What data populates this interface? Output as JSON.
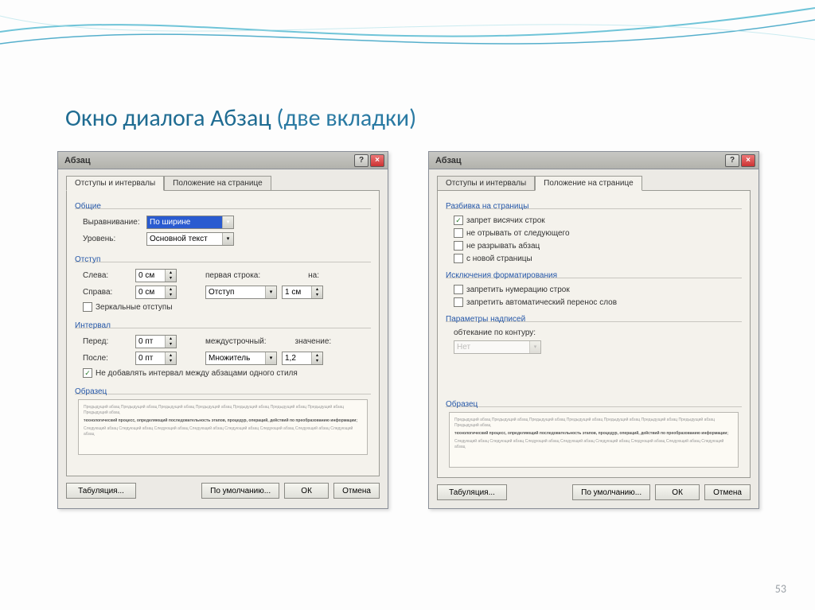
{
  "slide": {
    "title_main": "Окно диалога Абзац",
    "title_paren": "  (две вкладки)",
    "page_number": "53"
  },
  "dialog1": {
    "title": "Абзац",
    "tabs": {
      "t1": "Отступы и интервалы",
      "t2": "Положение на странице"
    },
    "group_general": "Общие",
    "alignment_label": "Выравнивание:",
    "alignment_value": "По ширине",
    "level_label": "Уровень:",
    "level_value": "Основной текст",
    "group_indent": "Отступ",
    "left_label": "Слева:",
    "left_value": "0 см",
    "right_label": "Справа:",
    "right_value": "0 см",
    "firstline_label": "первая строка:",
    "firstline_value": "Отступ",
    "by_label": "на:",
    "by_value": "1 см",
    "mirror": "Зеркальные отступы",
    "group_spacing": "Интервал",
    "before_label": "Перед:",
    "before_value": "0 пт",
    "after_label": "После:",
    "after_value": "0 пт",
    "linespace_label": "междустрочный:",
    "linespace_value": "Множитель",
    "linespace_at_label": "значение:",
    "linespace_at_value": "1,2",
    "nospace_same": "Не добавлять интервал между абзацами одного стиля",
    "group_preview": "Образец",
    "btn_tabs": "Табуляция...",
    "btn_default": "По умолчанию...",
    "btn_ok": "ОК",
    "btn_cancel": "Отмена"
  },
  "dialog2": {
    "title": "Абзац",
    "tabs": {
      "t1": "Отступы и интервалы",
      "t2": "Положение на странице"
    },
    "group_pagination": "Разбивка на страницы",
    "widow": "запрет висячих строк",
    "keepnext": "не отрывать от следующего",
    "keeplines": "не разрывать абзац",
    "pagebreak": "с новой страницы",
    "group_except": "Исключения форматирования",
    "suppress_line": "запретить нумерацию строк",
    "suppress_hyph": "запретить автоматический перенос слов",
    "group_textbox": "Параметры надписей",
    "wrap_label": "обтекание по контуру:",
    "wrap_value": "Нет",
    "group_preview": "Образец",
    "btn_tabs": "Табуляция...",
    "btn_default": "По умолчанию...",
    "btn_ok": "ОК",
    "btn_cancel": "Отмена"
  }
}
